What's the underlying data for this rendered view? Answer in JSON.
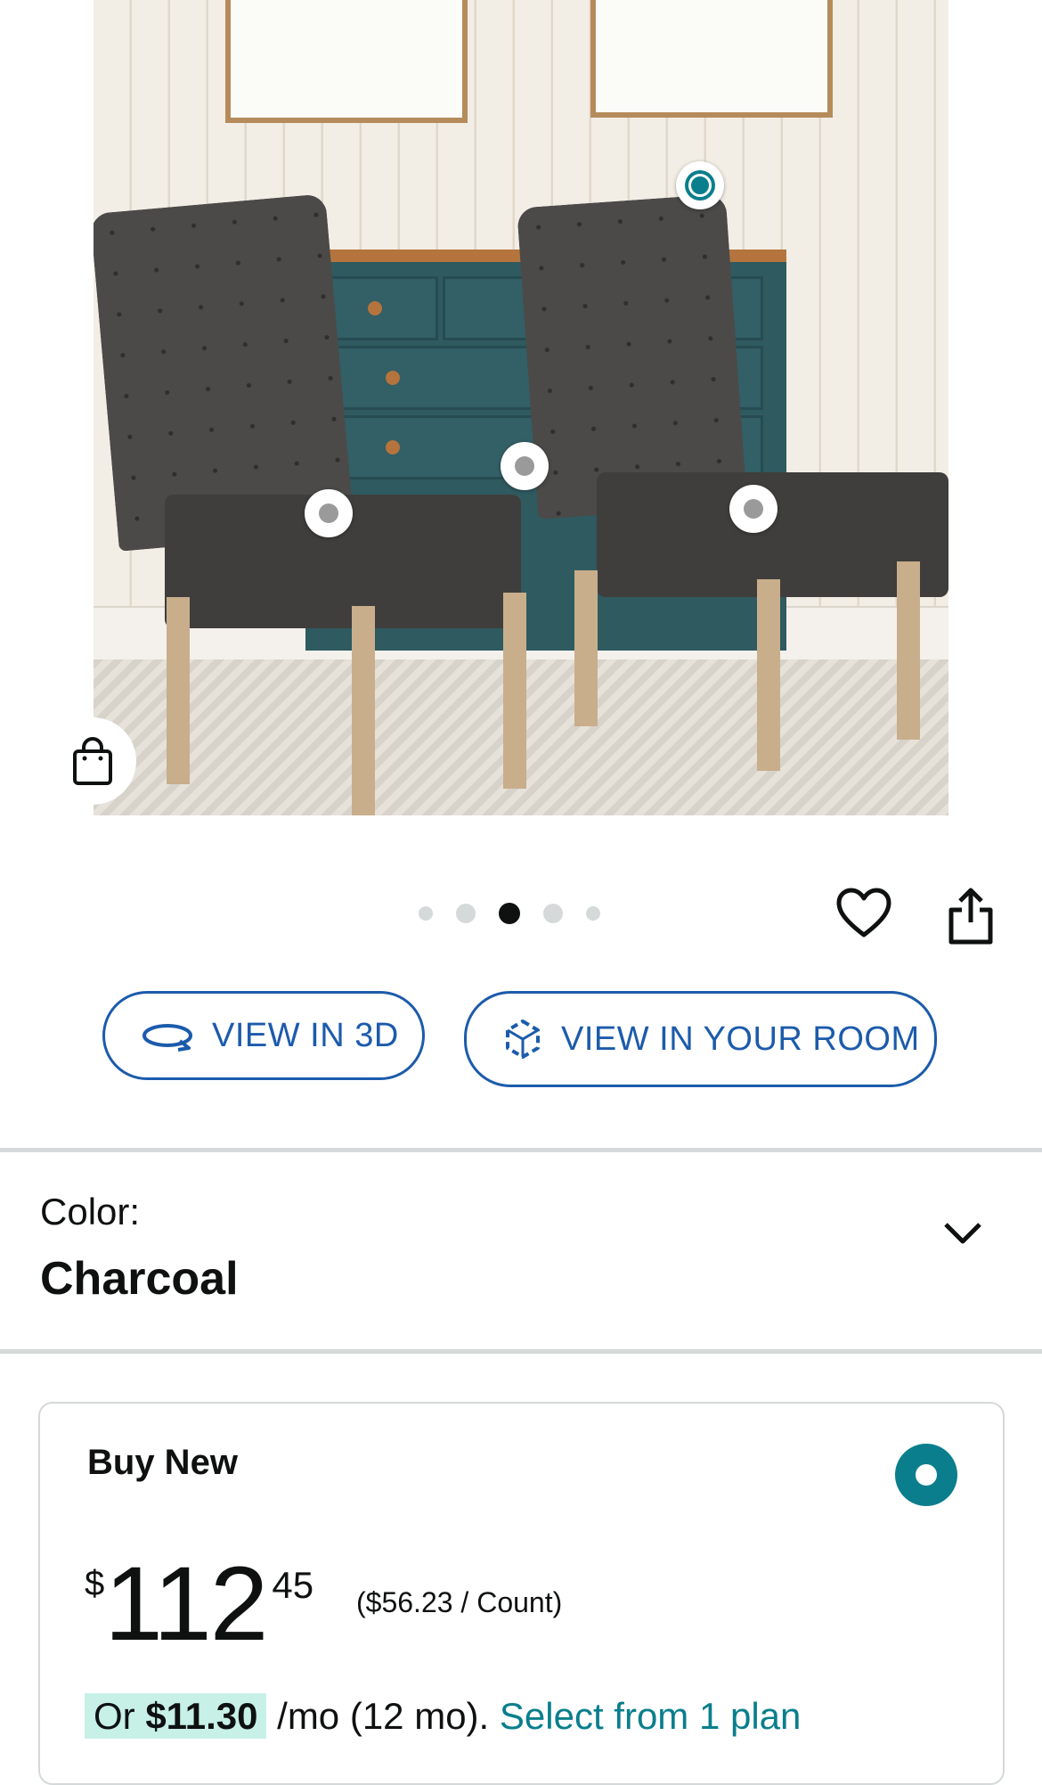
{
  "gallery": {
    "current_index": 3,
    "total": 5,
    "hotspot_count": 4
  },
  "buttons": {
    "view_3d": "VIEW IN 3D",
    "view_room": "VIEW IN YOUR ROOM"
  },
  "icons": {
    "bag": "shopping-bag-icon",
    "heart": "heart-icon",
    "share": "share-icon",
    "rotate_3d": "rotate-3d-icon",
    "ar_cube": "ar-cube-icon",
    "chevron": "chevron-down-icon"
  },
  "color_selector": {
    "label": "Color:",
    "value": "Charcoal"
  },
  "buy_box": {
    "title": "Buy New",
    "currency": "$",
    "price_whole": "112",
    "price_fraction": "45",
    "unit_price": "($56.23 / Count)",
    "plan_prefix": "Or ",
    "plan_amount": "$11.30",
    "plan_suffix": " /mo (12 mo). ",
    "plan_link": "Select from 1 plan"
  },
  "colors": {
    "accent_teal": "#0a7e8c",
    "link_blue": "#1c5bab",
    "highlight": "#c7f0e6"
  }
}
